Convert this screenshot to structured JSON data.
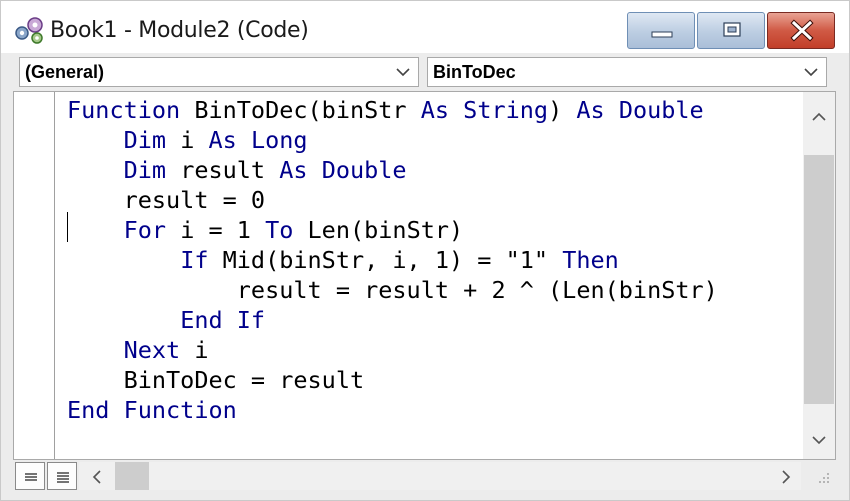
{
  "window": {
    "title": "Book1 - Module2 (Code)",
    "controls": {
      "minimize": "minimize",
      "maximize": "maximize",
      "close": "close"
    }
  },
  "toolbar": {
    "object_combo": "(General)",
    "procedure_combo": "BinToDec"
  },
  "code": {
    "lines": [
      [
        {
          "t": "Function",
          "k": true
        },
        {
          "t": " BinToDec(binStr "
        },
        {
          "t": "As",
          "k": true
        },
        {
          "t": " "
        },
        {
          "t": "String",
          "k": true
        },
        {
          "t": ") "
        },
        {
          "t": "As",
          "k": true
        },
        {
          "t": " "
        },
        {
          "t": "Double",
          "k": true
        }
      ],
      [
        {
          "t": "    "
        },
        {
          "t": "Dim",
          "k": true
        },
        {
          "t": " i "
        },
        {
          "t": "As",
          "k": true
        },
        {
          "t": " "
        },
        {
          "t": "Long",
          "k": true
        }
      ],
      [
        {
          "t": "    "
        },
        {
          "t": "Dim",
          "k": true
        },
        {
          "t": " result "
        },
        {
          "t": "As",
          "k": true
        },
        {
          "t": " "
        },
        {
          "t": "Double",
          "k": true
        }
      ],
      [
        {
          "t": "    result = 0"
        }
      ],
      [
        {
          "t": "    "
        },
        {
          "t": "For",
          "k": true
        },
        {
          "t": " i = 1 "
        },
        {
          "t": "To",
          "k": true
        },
        {
          "t": " Len(binStr)"
        }
      ],
      [
        {
          "t": "        "
        },
        {
          "t": "If",
          "k": true
        },
        {
          "t": " Mid(binStr, i, 1) = \"1\" "
        },
        {
          "t": "Then",
          "k": true
        }
      ],
      [
        {
          "t": "            result = result + 2 ^ (Len(binStr)"
        }
      ],
      [
        {
          "t": "        "
        },
        {
          "t": "End If",
          "k": true
        }
      ],
      [
        {
          "t": "    "
        },
        {
          "t": "Next",
          "k": true
        },
        {
          "t": " i"
        }
      ],
      [
        {
          "t": "    BinToDec = result"
        }
      ],
      [
        {
          "t": "End Function",
          "k": true
        }
      ]
    ]
  },
  "colors": {
    "keyword": "#00008b",
    "text": "#000000",
    "close_button": "#c9452f"
  },
  "icons": {
    "app": "vba-project-icon",
    "procedure_view": "procedure-view-icon",
    "full_module_view": "full-module-view-icon",
    "dropdown": "chevron-down-icon"
  }
}
